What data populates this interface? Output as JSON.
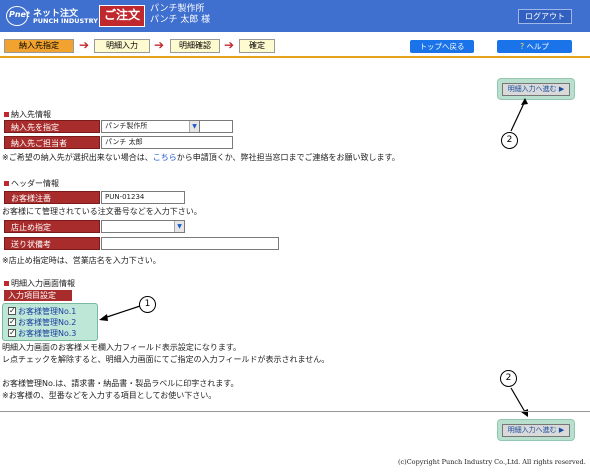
{
  "header": {
    "logo_badge": "Pnet",
    "logo_line1": "ネット注文",
    "logo_line2": "PUNCH INDUSTRY",
    "order_title": "ご注文",
    "company": "パンチ製作所",
    "user": "パンチ 太郎 様",
    "logout_label": "ログアウト"
  },
  "steps": [
    {
      "label": "納入先指定",
      "active": true
    },
    {
      "label": "明細入力",
      "active": false
    },
    {
      "label": "明細確認",
      "active": false
    },
    {
      "label": "確定",
      "active": false
    }
  ],
  "nav": {
    "top_label": "トップへ戻る",
    "help_label": "ヘルプ",
    "help_icon": "?"
  },
  "next_button_label": "明細入力へ進む ▶",
  "callouts": {
    "one": "1",
    "two_top": "2",
    "two_bottom": "2"
  },
  "delivery": {
    "section_title": "納入先情報",
    "dest_label": "納入先を指定",
    "dest_value": "パンチ製作所",
    "contact_label": "納入先ご担当者",
    "contact_value": "パンチ 太郎",
    "note_before": "※ご希望の納入先が選択出来ない場合は、",
    "note_link": "こちら",
    "note_after": "から申請頂くか、弊社担当窓口までご連絡をお願い致します。"
  },
  "header_info": {
    "section_title": "ヘッダー情報",
    "customer_order_label": "お客様注番",
    "customer_order_value": "PUN-01234",
    "customer_order_note": "お客様にて管理されている注文番号などを入力下さい。",
    "store_label": "店止め指定",
    "store_value": "",
    "invoice_label": "送り状備考",
    "invoice_value": "",
    "store_note": "※店止め指定時は、営業店名を入力下さい。"
  },
  "detail_screen": {
    "section_title": "明細入力画面情報",
    "input_items_label": "入力項目設定",
    "checkboxes": [
      {
        "label": "お客様管理No.1",
        "checked": true
      },
      {
        "label": "お客様管理No.2",
        "checked": true
      },
      {
        "label": "お客様管理No.3",
        "checked": true
      }
    ],
    "note1": "明細入力画面のお客様メモ欄入力フィールド表示設定になります。",
    "note2": "レ点チェックを解除すると、明細入力画面にてご指定の入力フィールドが表示されません。",
    "note3": "お客様管理No.は、請求書・納品書・製品ラベルに印字されます。",
    "note4": "※お客様の、型番などを入力する項目としてお使い下さい。"
  },
  "footer": {
    "copyright": "(c)Copyright Punch Industry Co.,Ltd. All rights reserved."
  },
  "colors": {
    "header_bg": "#3f6fcf",
    "accent_red": "#c0282e",
    "label_bg": "#a82c2c",
    "step_active": "#f2a32f",
    "step_inactive": "#fffbd0",
    "nav_blue": "#1a73e8",
    "mint": "#bfe7d8"
  },
  "icons": {
    "step_arrow": "arrow-right-icon",
    "select_arrow": "chevron-down-icon",
    "help": "question-icon",
    "next": "play-triangle-icon"
  }
}
